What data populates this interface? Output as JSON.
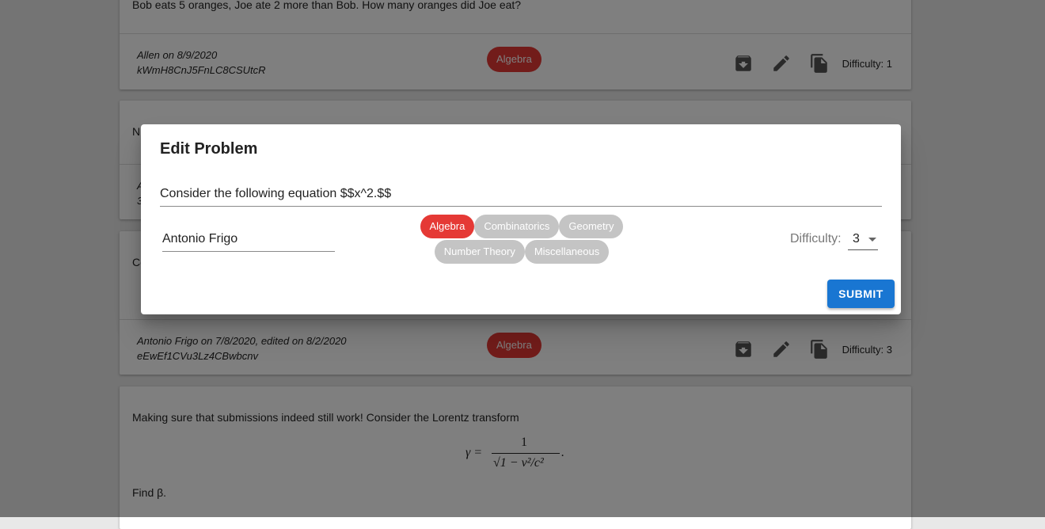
{
  "background": {
    "cards": [
      {
        "body": "Bob eats 5 oranges, Joe ate 2 more than Bob. How many oranges did Joe eat?",
        "meta_line1": "Allen on 8/9/2020",
        "meta_line2": "kWmH8CnJ5FnLC8CSUtcR",
        "tag": "Algebra",
        "difficulty": "Difficulty: 1"
      },
      {
        "body_fragment": "N",
        "meta_fragment_1": "A",
        "meta_fragment_2": "3"
      },
      {
        "body_fragment": "Co",
        "meta_line1": "Antonio Frigo on 7/8/2020, edited on 8/2/2020",
        "meta_line2": "eEwEf1CVu3Lz4CBwbcnv",
        "tag": "Algebra",
        "difficulty": "Difficulty: 3"
      },
      {
        "body": "Making sure that submissions indeed still work! Consider the Lorentz transform",
        "formula_lhs": "γ =",
        "formula_num": "1",
        "formula_den": "√1 − v²/c²",
        "formula_end": ".",
        "find": "Find β."
      }
    ]
  },
  "dialog": {
    "title": "Edit Problem",
    "problem_text": "Consider the following equation $$x^2.$$",
    "author": "Antonio Frigo",
    "tags": [
      "Algebra",
      "Combinatorics",
      "Geometry",
      "Number Theory",
      "Miscellaneous"
    ],
    "selected_tag": "Algebra",
    "difficulty_label": "Difficulty:",
    "difficulty_value": "3",
    "submit_label": "SUBMIT"
  },
  "colors": {
    "accent": "#e53935",
    "primary": "#1976d2",
    "chip_inactive": "#c4c4c4"
  }
}
